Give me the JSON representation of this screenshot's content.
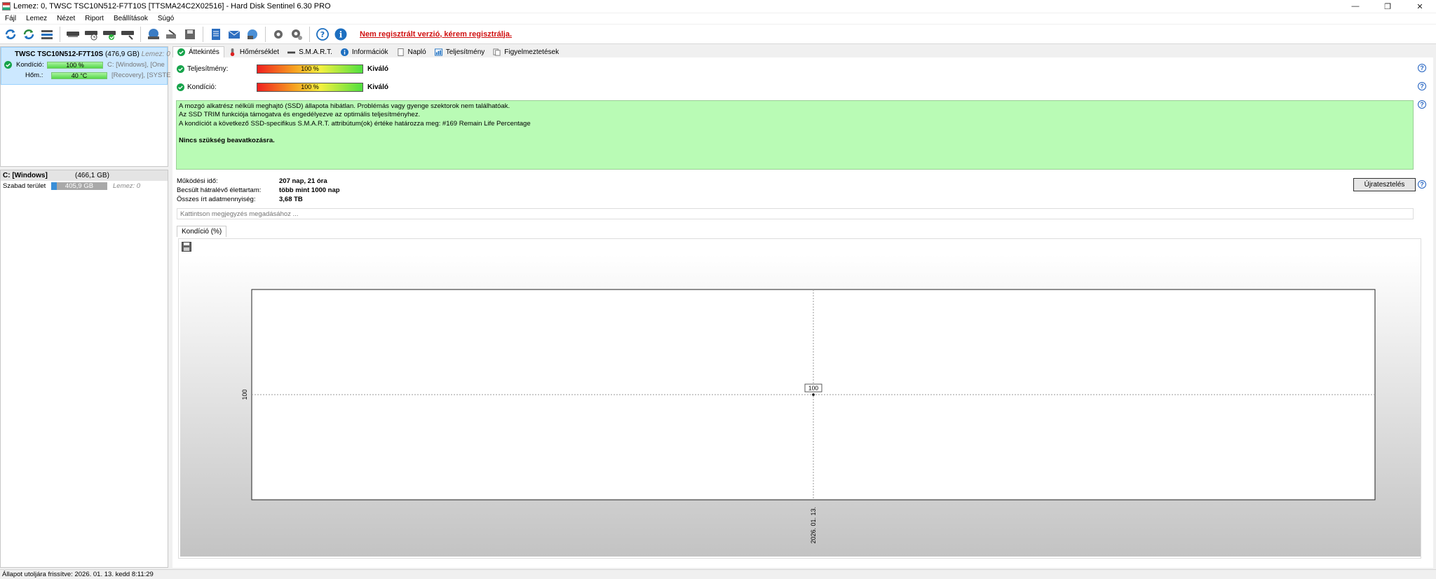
{
  "window": {
    "title": "Lemez: 0, TWSC TSC10N512-F7T10S [TTSMA24C2X02516]  -  Hard Disk Sentinel 6.30 PRO"
  },
  "menu": [
    "Fájl",
    "Lemez",
    "Nézet",
    "Riport",
    "Beállítások",
    "Súgó"
  ],
  "toolbar": {
    "register_text": "Nem regisztrált verzió, kérem regisztrálja.",
    "buttons": [
      "refresh-icon",
      "refresh-all-icon",
      "disk-list-icon",
      "disk-icon",
      "disk-test-icon",
      "disk-check-icon",
      "disk-surface-icon",
      "drive-icon",
      "tools-icon",
      "save-disk-icon",
      "report-icon",
      "mail-icon",
      "network-icon",
      "settings-icon",
      "settings-alt-icon",
      "help-icon",
      "info-icon"
    ]
  },
  "disk": {
    "name": "TWSC TSC10N512-F7T10S",
    "size": "(476,9 GB)",
    "index": "Lemez: 0",
    "condition_label": "Kondíció:",
    "condition_value": "100 %",
    "temp_label": "Hőm.:",
    "temp_value": "40 °C",
    "partitions_1": "C: [Windows],  [One",
    "partitions_2": "[Recovery],  [SYSTE"
  },
  "volume": {
    "name": "C: [Windows]",
    "size": "(466,1 GB)",
    "free_label": "Szabad terület",
    "free_value": "405,9 GB",
    "disk_ref": "Lemez: 0"
  },
  "tabs": [
    "Áttekintés",
    "Hőmérséklet",
    "S.M.A.R.T.",
    "Információk",
    "Napló",
    "Teljesítmény",
    "Figyelmeztetések"
  ],
  "overview": {
    "performance_label": "Teljesítmény:",
    "performance_value": "100 %",
    "performance_rating": "Kiváló",
    "condition_label": "Kondíció:",
    "condition_value": "100 %",
    "condition_rating": "Kiváló",
    "info_lines": [
      "A mozgó alkatrész nélküli meghajtó (SSD) állapota hibátlan. Problémás vagy gyenge szektorok nem találhatóak.",
      "Az SSD TRIM funkciója támogatva és engedélyezve az optimális teljesítményhez.",
      "A kondíciót a következő SSD-specifikus S.M.A.R.T. attribútum(ok) értéke határozza meg:  #169 Remain Life Percentage"
    ],
    "info_action": "Nincs szükség beavatkozásra.",
    "uptime_label": "Működési idő:",
    "uptime_value": "207 nap, 21 óra",
    "life_label": "Becsült hátralévő élettartam:",
    "life_value": "több mint 1000 nap",
    "written_label": "Összes írt adatmennyiség:",
    "written_value": "3,68 TB",
    "retest_button": "Újratesztelés",
    "note_placeholder": "Kattintson megjegyzés megadásához ..."
  },
  "chart_tab": "Kondíció  (%)",
  "chart_data": {
    "type": "line",
    "x": [
      "2026. 01. 13."
    ],
    "series": [
      {
        "values": [
          100
        ]
      }
    ],
    "yticks": [
      "100"
    ],
    "xticks": [
      "2026. 01. 13."
    ],
    "data_labels": [
      "100"
    ]
  },
  "statusbar": {
    "text": "Állapot utoljára frissítve: 2026. 01. 13. kedd 8:11:29"
  }
}
